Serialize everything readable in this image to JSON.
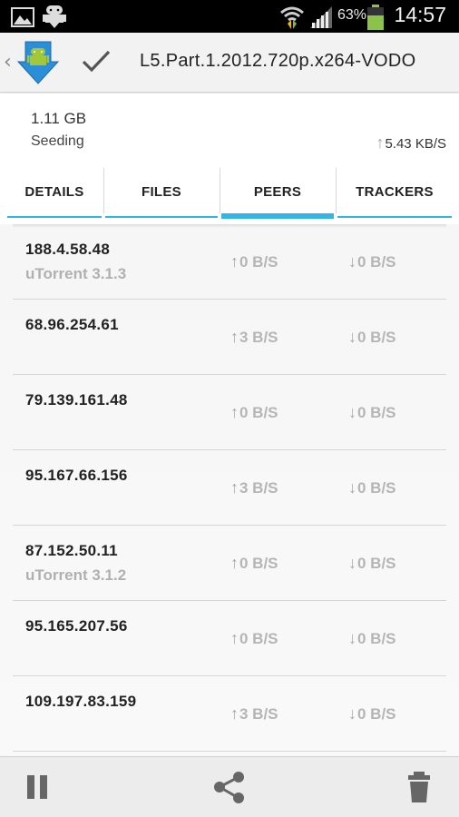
{
  "status_bar": {
    "battery_percent": "63%",
    "time": "14:57",
    "icons": [
      "image-icon",
      "android-download-icon",
      "wifi-icon",
      "signal-icon",
      "battery-icon"
    ]
  },
  "action_bar": {
    "title": "L5.Part.1.2012.720p.x264-VODO",
    "icons": [
      "back-chevron-icon",
      "app-download-icon",
      "check-icon"
    ]
  },
  "summary": {
    "size": "1.11 GB",
    "state": "Seeding",
    "upload_rate": "5.43 KB/S"
  },
  "tabs": [
    {
      "label": "DETAILS",
      "active": false
    },
    {
      "label": "FILES",
      "active": false
    },
    {
      "label": "PEERS",
      "active": true
    },
    {
      "label": "TRACKERS",
      "active": false
    }
  ],
  "peers": [
    {
      "ip": "188.4.58.48",
      "client": "uTorrent 3.1.3",
      "up": "0 B/S",
      "down": "0 B/S"
    },
    {
      "ip": "68.96.254.61",
      "client": "",
      "up": "3 B/S",
      "down": "0 B/S"
    },
    {
      "ip": "79.139.161.48",
      "client": "",
      "up": "0 B/S",
      "down": "0 B/S"
    },
    {
      "ip": "95.167.66.156",
      "client": "",
      "up": "3 B/S",
      "down": "0 B/S"
    },
    {
      "ip": "87.152.50.11",
      "client": "uTorrent 3.1.2",
      "up": "0 B/S",
      "down": "0 B/S"
    },
    {
      "ip": "95.165.207.56",
      "client": "",
      "up": "0 B/S",
      "down": "0 B/S"
    },
    {
      "ip": "109.197.83.159",
      "client": "",
      "up": "3 B/S",
      "down": "0 B/S"
    }
  ],
  "bottom_bar": {
    "icons": [
      "pause-icon",
      "share-icon",
      "delete-icon"
    ]
  },
  "colors": {
    "accent": "#33b5e5",
    "app_icon_blue": "#2a8fd6",
    "android_green": "#a4c639"
  }
}
